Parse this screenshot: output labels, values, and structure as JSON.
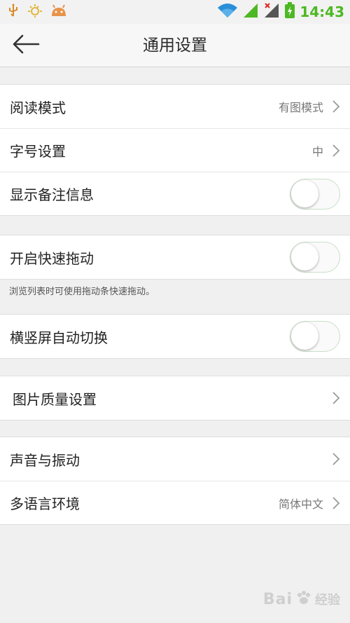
{
  "status_bar": {
    "time": "14:43",
    "icons": [
      "usb-icon",
      "weather-icon",
      "android-icon",
      "wifi-icon",
      "signal-icon",
      "no-signal-icon",
      "battery-charging-icon"
    ],
    "time_color": "#4db823"
  },
  "header": {
    "title": "通用设置",
    "back_icon": "back-arrow-icon"
  },
  "groups": [
    {
      "items": [
        {
          "label": "阅读模式",
          "value": "有图模式",
          "control": "chevron"
        },
        {
          "label": "字号设置",
          "value": "中",
          "control": "chevron"
        },
        {
          "label": "显示备注信息",
          "control": "toggle",
          "on": false
        }
      ]
    },
    {
      "items": [
        {
          "label": "开启快速拖动",
          "control": "toggle",
          "on": false
        }
      ],
      "hint": "浏览列表时可使用拖动条快速拖动。"
    },
    {
      "items": [
        {
          "label": "横竖屏自动切换",
          "control": "toggle",
          "on": false
        }
      ]
    },
    {
      "items": [
        {
          "label": "图片质量设置",
          "control": "chevron"
        }
      ]
    },
    {
      "items": [
        {
          "label": "声音与振动",
          "control": "chevron"
        },
        {
          "label": "多语言环境",
          "value": "简体中文",
          "control": "chevron"
        }
      ]
    }
  ],
  "watermark": {
    "text": "Bai",
    "sub": "经验"
  },
  "colors": {
    "background": "#f0f0f0",
    "row_background": "#ffffff",
    "accent_green": "#4db823"
  }
}
